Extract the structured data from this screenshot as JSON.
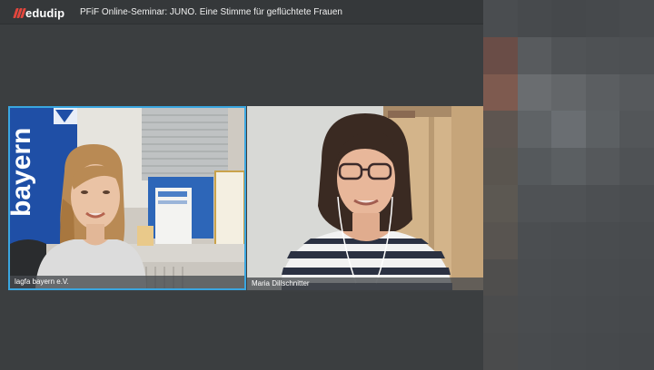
{
  "app": {
    "logo_text": "edudip",
    "accent": "#e2463d"
  },
  "session": {
    "title": "PFiF Online-Seminar: JUNO. Eine Stimme für geflüchtete Frauen"
  },
  "participants": [
    {
      "name": "lagfa bayern e.V.",
      "active_speaker": true
    },
    {
      "name": "Maria Dillschnitter",
      "active_speaker": false
    }
  ],
  "banner_text": "bayern",
  "colors": {
    "active_border": "#3aa6e0",
    "background": "#3b3e40"
  }
}
